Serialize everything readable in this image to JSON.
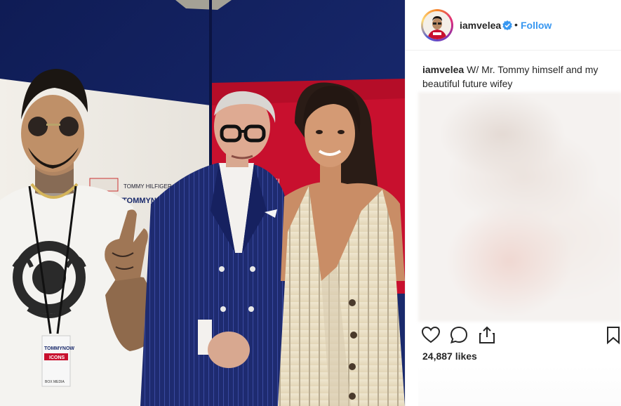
{
  "post": {
    "username": "iamvelea",
    "follow_label": "Follow",
    "separator": "•",
    "caption_user": "iamvelea",
    "caption_text": "W/ Mr. Tommy himself and my beautiful future wifey",
    "likes": "24,887 likes",
    "verified": true
  },
  "photo_text": {
    "banner_brand": "TOMMY HILFIGER",
    "hashtag": "#TOMMYNOW",
    "hilfiger_partial": "HILFI",
    "badge_line1": "TOMMYNOW",
    "badge_line2": "ICONS",
    "badge_line3": "BOX MEDIA"
  },
  "icons": {
    "like": "heart-icon",
    "comment": "comment-icon",
    "share": "share-icon",
    "save": "bookmark-icon",
    "verified": "verified-badge-icon"
  },
  "colors": {
    "link_blue": "#3897f0",
    "text": "#262626",
    "navy_backdrop": "#1a2a6c",
    "red_backdrop": "#c8102e"
  }
}
